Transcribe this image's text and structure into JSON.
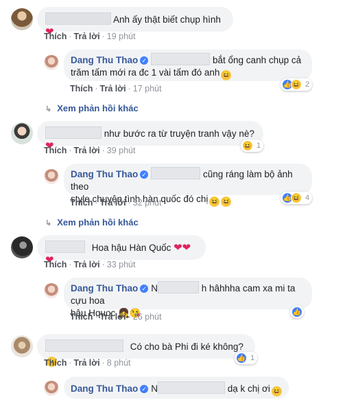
{
  "labels": {
    "like": "Thích",
    "reply": "Trả lời",
    "separator": "·",
    "more_replies": "Xem phản hồi khác"
  },
  "colors": {
    "name": "#365899",
    "bubble": "#f2f3f5",
    "heart": "#e0245e",
    "like": "#4080ff",
    "haha": "#f7c844"
  },
  "comments": [
    {
      "text": "Anh ấy thật biết chụp hình",
      "emoji": "heart",
      "time": "19 phút",
      "reply": {
        "author": "Dang Thu Thao",
        "line1": "bắt ổng canh chụp cả",
        "line2": "trăm tấm mới ra đc 1 vài tấm đó anh",
        "line2_emoji": "haha",
        "time": "17 phút",
        "reactions": [
          "like",
          "haha"
        ],
        "reaction_count": "2"
      }
    },
    {
      "text": "như bước ra từ truyện tranh vậy nè?",
      "emoji": "heart",
      "time": "39 phút",
      "reactions": [
        "haha"
      ],
      "reaction_count": "1",
      "reply": {
        "author": "Dang Thu Thao",
        "line1": "cũng ráng làm bộ ảnh theo",
        "line2": "style chuyện tình hàn quốc đó chị",
        "line2_emoji": "haha haha",
        "time": "32 phút",
        "reactions": [
          "like",
          "haha"
        ],
        "reaction_count": "4"
      }
    },
    {
      "text": "Hoa hậu Hàn Quốc",
      "emoji": "heart heart heart",
      "time": "33 phút",
      "reply": {
        "author": "Dang Thu Thao",
        "prefix": "N",
        "line1": "h hâhhha cam xa mi ta cựu hoa",
        "line2": "hậu Hquoc",
        "line2_emoji": "girl kiss",
        "time": "26 phút",
        "reactions": [
          "like"
        ]
      }
    },
    {
      "text": "Có cho bà Phi đi ké không?",
      "emoji": "smile",
      "time": "8 phút",
      "reactions": [
        "like"
      ],
      "reaction_count": "1",
      "reply": {
        "author": "Dang Thu Thao",
        "prefix": "N",
        "line1": "dạ k chị ơi",
        "line2_emoji": "haha"
      }
    }
  ]
}
